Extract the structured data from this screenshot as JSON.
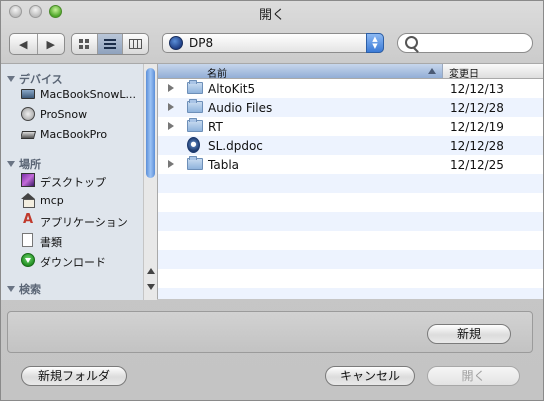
{
  "window": {
    "title": "開く"
  },
  "toolbar": {
    "nav": {
      "back": "◀",
      "forward": "▶"
    },
    "view_modes": [
      "icon-view",
      "list-view",
      "column-view"
    ],
    "active_view": 1,
    "path": {
      "label": "DP8",
      "icon": "disk-icon"
    },
    "search": {
      "value": "",
      "placeholder": ""
    }
  },
  "sidebar": {
    "sections": {
      "devices": "デバイス",
      "places": "場所",
      "search": "検索"
    },
    "devices": [
      {
        "label": "MacBookSnowL...",
        "icon": "laptop-icon"
      },
      {
        "label": "ProSnow",
        "icon": "disc-icon"
      },
      {
        "label": "MacBookPro",
        "icon": "laptop-small-icon"
      }
    ],
    "places": [
      {
        "label": "デスクトップ",
        "icon": "desktop-icon"
      },
      {
        "label": "mcp",
        "icon": "home-icon"
      },
      {
        "label": "アプリケーション",
        "icon": "applications-icon"
      },
      {
        "label": "書類",
        "icon": "documents-icon"
      },
      {
        "label": "ダウンロード",
        "icon": "downloads-icon"
      }
    ]
  },
  "file_list": {
    "columns": {
      "name": "名前",
      "date": "変更日"
    },
    "sort": "name-ascending",
    "rows": [
      {
        "name": "AltoKit5",
        "date": "12/12/13",
        "kind": "folder"
      },
      {
        "name": "Audio Files",
        "date": "12/12/28",
        "kind": "folder"
      },
      {
        "name": "RT",
        "date": "12/12/19",
        "kind": "folder"
      },
      {
        "name": "SL.dpdoc",
        "date": "12/12/28",
        "kind": "document"
      },
      {
        "name": "Tabla",
        "date": "12/12/25",
        "kind": "folder"
      }
    ]
  },
  "accessory": {
    "new_label": "新規"
  },
  "buttons": {
    "new_folder": "新規フォルダ",
    "cancel": "キャンセル",
    "open": "開く"
  },
  "colors": {
    "selection_header": "#92aed6",
    "row_stripe": "#edf3fe",
    "sidebar_bg": "#dfe5ec"
  }
}
